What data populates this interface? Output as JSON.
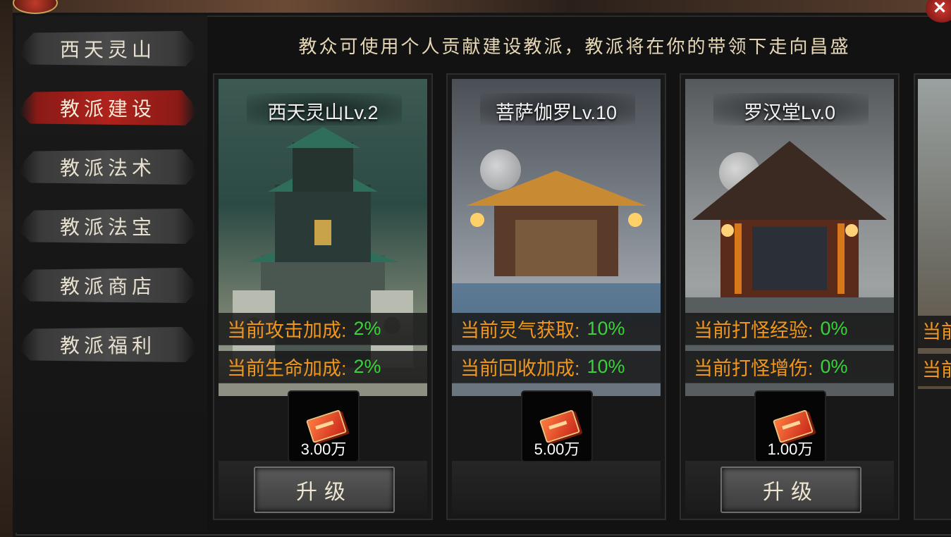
{
  "sidebar": {
    "tabs": [
      {
        "label": "西天灵山",
        "active": false
      },
      {
        "label": "教派建设",
        "active": true
      },
      {
        "label": "教派法术",
        "active": false
      },
      {
        "label": "教派法宝",
        "active": false
      },
      {
        "label": "教派商店",
        "active": false
      },
      {
        "label": "教派福利",
        "active": false
      }
    ]
  },
  "banner": "教众可使用个人贡献建设教派，教派将在你的带领下走向昌盛",
  "cards": [
    {
      "title": "西天灵山Lv.2",
      "stats": [
        {
          "label": "当前攻击加成:",
          "value": "2%"
        },
        {
          "label": "当前生命加成:",
          "value": "2%"
        }
      ],
      "cost": "3.00万",
      "button": "升级"
    },
    {
      "title": "菩萨伽罗Lv.10",
      "stats": [
        {
          "label": "当前灵气获取:",
          "value": "10%"
        },
        {
          "label": "当前回收加成:",
          "value": "10%"
        }
      ],
      "cost": "5.00万",
      "button": ""
    },
    {
      "title": "罗汉堂Lv.0",
      "stats": [
        {
          "label": "当前打怪经验:",
          "value": "0%"
        },
        {
          "label": "当前打怪增伤:",
          "value": "0%"
        }
      ],
      "cost": "1.00万",
      "button": "升级"
    }
  ],
  "partial_card": {
    "stat1": "当前",
    "stat2": "当前"
  },
  "close_icon": "close-icon",
  "colors": {
    "stat_label": "#f0961c",
    "stat_value": "#3ad13a",
    "active_tab": "#b0221c"
  }
}
